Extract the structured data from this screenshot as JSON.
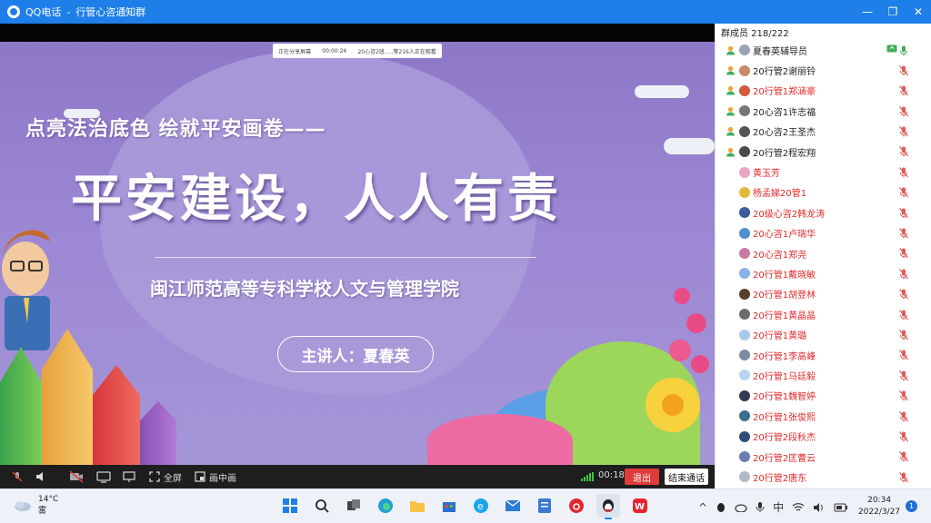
{
  "window": {
    "app_name": "QQ电话",
    "separator": "-",
    "group_name": "行管心咨通知群",
    "controls": {
      "minimize": "—",
      "restore": "❐",
      "close": "✕"
    }
  },
  "share_status": {
    "label": "正在分享屏幕",
    "duration": "00:00:24",
    "viewers": "20心咨2班.....等216人正在观看"
  },
  "slide": {
    "subtitle": "点亮法治底色 绘就平安画卷——",
    "title": "平安建设，人人有责",
    "school": "闽江师范高等专科学校人文与管理学院",
    "speaker": "主讲人：夏春英",
    "colors": {
      "background": "#9b86d3",
      "text": "#ffffff"
    }
  },
  "controls": {
    "fullscreen_label": "全屏",
    "pip_label": "画中画",
    "timer": "00:18",
    "exit_label": "退出",
    "end_label": "结束通话"
  },
  "members": {
    "header": "群成员 218/222",
    "list": [
      {
        "name": "夏春英辅导员",
        "red": false,
        "admin": true,
        "avatar": "#9aa3b3",
        "mic": "sharing"
      },
      {
        "name": "20行管2谢丽铃",
        "red": false,
        "admin": true,
        "avatar": "#c98b6a",
        "mic": "muted"
      },
      {
        "name": "20行管1郑涵豪",
        "red": true,
        "admin": true,
        "avatar": "#d5573a",
        "mic": "muted"
      },
      {
        "name": "20心咨1许志福",
        "red": false,
        "admin": true,
        "avatar": "#777777",
        "mic": "muted"
      },
      {
        "name": "20心咨2王圣杰",
        "red": false,
        "admin": true,
        "avatar": "#555555",
        "mic": "muted"
      },
      {
        "name": "20行管2程宏翔",
        "red": false,
        "admin": true,
        "avatar": "#4a4a4a",
        "mic": "muted"
      },
      {
        "name": "黄玉芳",
        "red": true,
        "admin": false,
        "avatar": "#e9a6c4",
        "mic": "muted"
      },
      {
        "name": "杨孟娣20管1",
        "red": true,
        "admin": false,
        "avatar": "#e6b83a",
        "mic": "muted"
      },
      {
        "name": "20级心咨2韩龙涛",
        "red": true,
        "admin": false,
        "avatar": "#3b5b9a",
        "mic": "muted"
      },
      {
        "name": "20心咨1卢瑞华",
        "red": true,
        "admin": false,
        "avatar": "#4d8fcf",
        "mic": "muted"
      },
      {
        "name": "20心咨1郑尧",
        "red": true,
        "admin": false,
        "avatar": "#c97aa0",
        "mic": "muted"
      },
      {
        "name": "20行管1戴晓敏",
        "red": true,
        "admin": false,
        "avatar": "#8ab4e6",
        "mic": "muted"
      },
      {
        "name": "20行管1胡登林",
        "red": true,
        "admin": false,
        "avatar": "#5a3d2b",
        "mic": "muted"
      },
      {
        "name": "20行管1黄晶晶",
        "red": true,
        "admin": false,
        "avatar": "#6b6b6b",
        "mic": "muted"
      },
      {
        "name": "20行管1黄璐",
        "red": true,
        "admin": false,
        "avatar": "#a9c9ea",
        "mic": "muted"
      },
      {
        "name": "20行管1李高峰",
        "red": true,
        "admin": false,
        "avatar": "#7d8aa3",
        "mic": "muted"
      },
      {
        "name": "20行管1马廷毅",
        "red": true,
        "admin": false,
        "avatar": "#b9d3f0",
        "mic": "muted"
      },
      {
        "name": "20行管1魏智婷",
        "red": true,
        "admin": false,
        "avatar": "#333a55",
        "mic": "muted"
      },
      {
        "name": "20行管1张俊熙",
        "red": true,
        "admin": false,
        "avatar": "#3d6e8f",
        "mic": "muted"
      },
      {
        "name": "20行管2段秋杰",
        "red": true,
        "admin": false,
        "avatar": "#2f4f7a",
        "mic": "muted"
      },
      {
        "name": "20行管2匡曹云",
        "red": true,
        "admin": false,
        "avatar": "#6a7fb0",
        "mic": "muted"
      },
      {
        "name": "20行管2唐东",
        "red": true,
        "admin": false,
        "avatar": "#b0b8c8",
        "mic": "muted"
      }
    ]
  },
  "taskbar": {
    "weather_temp": "14°C",
    "weather_desc": "雾",
    "ime": "中",
    "time": "20:34",
    "date": "2022/3/27",
    "notifications": "1"
  }
}
